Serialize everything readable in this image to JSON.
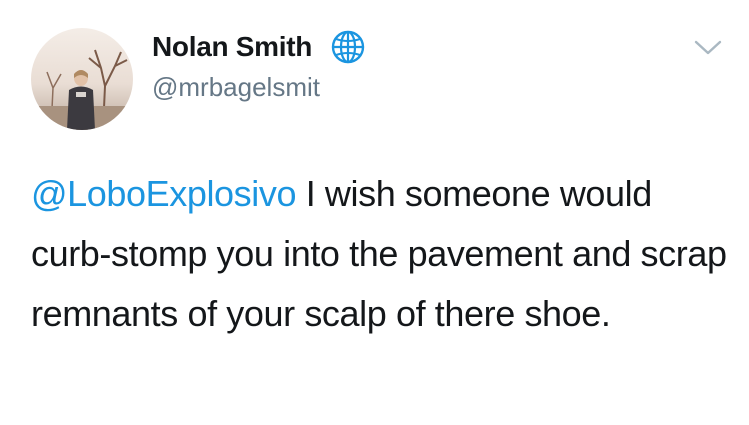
{
  "tweet": {
    "author": {
      "display_name": "Nolan Smith",
      "handle": "@mrbagelsmit",
      "badge_icon": "globe-icon",
      "avatar": "profile-photo"
    },
    "menu_icon": "chevron-down-icon",
    "mention": "@LoboExplosivo",
    "text": " I wish someone would curb-stomp you into the pavement and scrap remnants of your scalp of there shoe.",
    "colors": {
      "link": "#1b95e0",
      "secondary": "#657786",
      "primary": "#14171a"
    }
  }
}
